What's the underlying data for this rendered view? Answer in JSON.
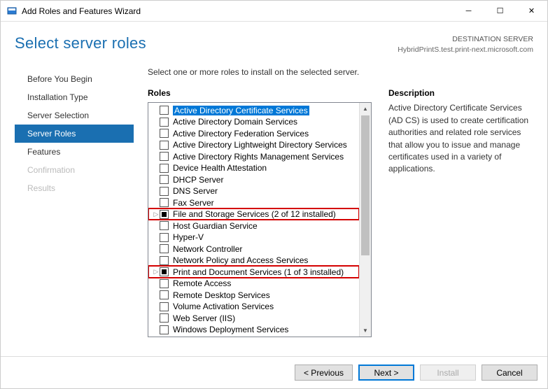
{
  "window": {
    "title": "Add Roles and Features Wizard"
  },
  "header": {
    "page_title": "Select server roles",
    "destination_label": "DESTINATION SERVER",
    "destination_value": "HybridPrintS.test.print-next.microsoft.com"
  },
  "sidebar": {
    "items": [
      {
        "label": "Before You Begin",
        "state": "normal"
      },
      {
        "label": "Installation Type",
        "state": "normal"
      },
      {
        "label": "Server Selection",
        "state": "normal"
      },
      {
        "label": "Server Roles",
        "state": "active"
      },
      {
        "label": "Features",
        "state": "normal"
      },
      {
        "label": "Confirmation",
        "state": "disabled"
      },
      {
        "label": "Results",
        "state": "disabled"
      }
    ]
  },
  "content": {
    "instruction": "Select one or more roles to install on the selected server.",
    "roles_header": "Roles",
    "description_header": "Description",
    "description_text": "Active Directory Certificate Services (AD CS) is used to create certification authorities and related role services that allow you to issue and manage certificates used in a variety of applications.",
    "roles": [
      {
        "label": "Active Directory Certificate Services",
        "checked": "none",
        "selected": true,
        "expandable": false,
        "highlight": false
      },
      {
        "label": "Active Directory Domain Services",
        "checked": "none",
        "selected": false,
        "expandable": false,
        "highlight": false
      },
      {
        "label": "Active Directory Federation Services",
        "checked": "none",
        "selected": false,
        "expandable": false,
        "highlight": false
      },
      {
        "label": "Active Directory Lightweight Directory Services",
        "checked": "none",
        "selected": false,
        "expandable": false,
        "highlight": false
      },
      {
        "label": "Active Directory Rights Management Services",
        "checked": "none",
        "selected": false,
        "expandable": false,
        "highlight": false
      },
      {
        "label": "Device Health Attestation",
        "checked": "none",
        "selected": false,
        "expandable": false,
        "highlight": false
      },
      {
        "label": "DHCP Server",
        "checked": "none",
        "selected": false,
        "expandable": false,
        "highlight": false
      },
      {
        "label": "DNS Server",
        "checked": "none",
        "selected": false,
        "expandable": false,
        "highlight": false
      },
      {
        "label": "Fax Server",
        "checked": "none",
        "selected": false,
        "expandable": false,
        "highlight": false
      },
      {
        "label": "File and Storage Services (2 of 12 installed)",
        "checked": "partial",
        "selected": false,
        "expandable": true,
        "highlight": true
      },
      {
        "label": "Host Guardian Service",
        "checked": "none",
        "selected": false,
        "expandable": false,
        "highlight": false
      },
      {
        "label": "Hyper-V",
        "checked": "none",
        "selected": false,
        "expandable": false,
        "highlight": false
      },
      {
        "label": "Network Controller",
        "checked": "none",
        "selected": false,
        "expandable": false,
        "highlight": false
      },
      {
        "label": "Network Policy and Access Services",
        "checked": "none",
        "selected": false,
        "expandable": false,
        "highlight": false
      },
      {
        "label": "Print and Document Services (1 of 3 installed)",
        "checked": "partial",
        "selected": false,
        "expandable": true,
        "highlight": true
      },
      {
        "label": "Remote Access",
        "checked": "none",
        "selected": false,
        "expandable": false,
        "highlight": false
      },
      {
        "label": "Remote Desktop Services",
        "checked": "none",
        "selected": false,
        "expandable": false,
        "highlight": false
      },
      {
        "label": "Volume Activation Services",
        "checked": "none",
        "selected": false,
        "expandable": false,
        "highlight": false
      },
      {
        "label": "Web Server (IIS)",
        "checked": "none",
        "selected": false,
        "expandable": false,
        "highlight": false
      },
      {
        "label": "Windows Deployment Services",
        "checked": "none",
        "selected": false,
        "expandable": false,
        "highlight": false
      }
    ]
  },
  "footer": {
    "previous": "< Previous",
    "next": "Next >",
    "install": "Install",
    "cancel": "Cancel"
  }
}
